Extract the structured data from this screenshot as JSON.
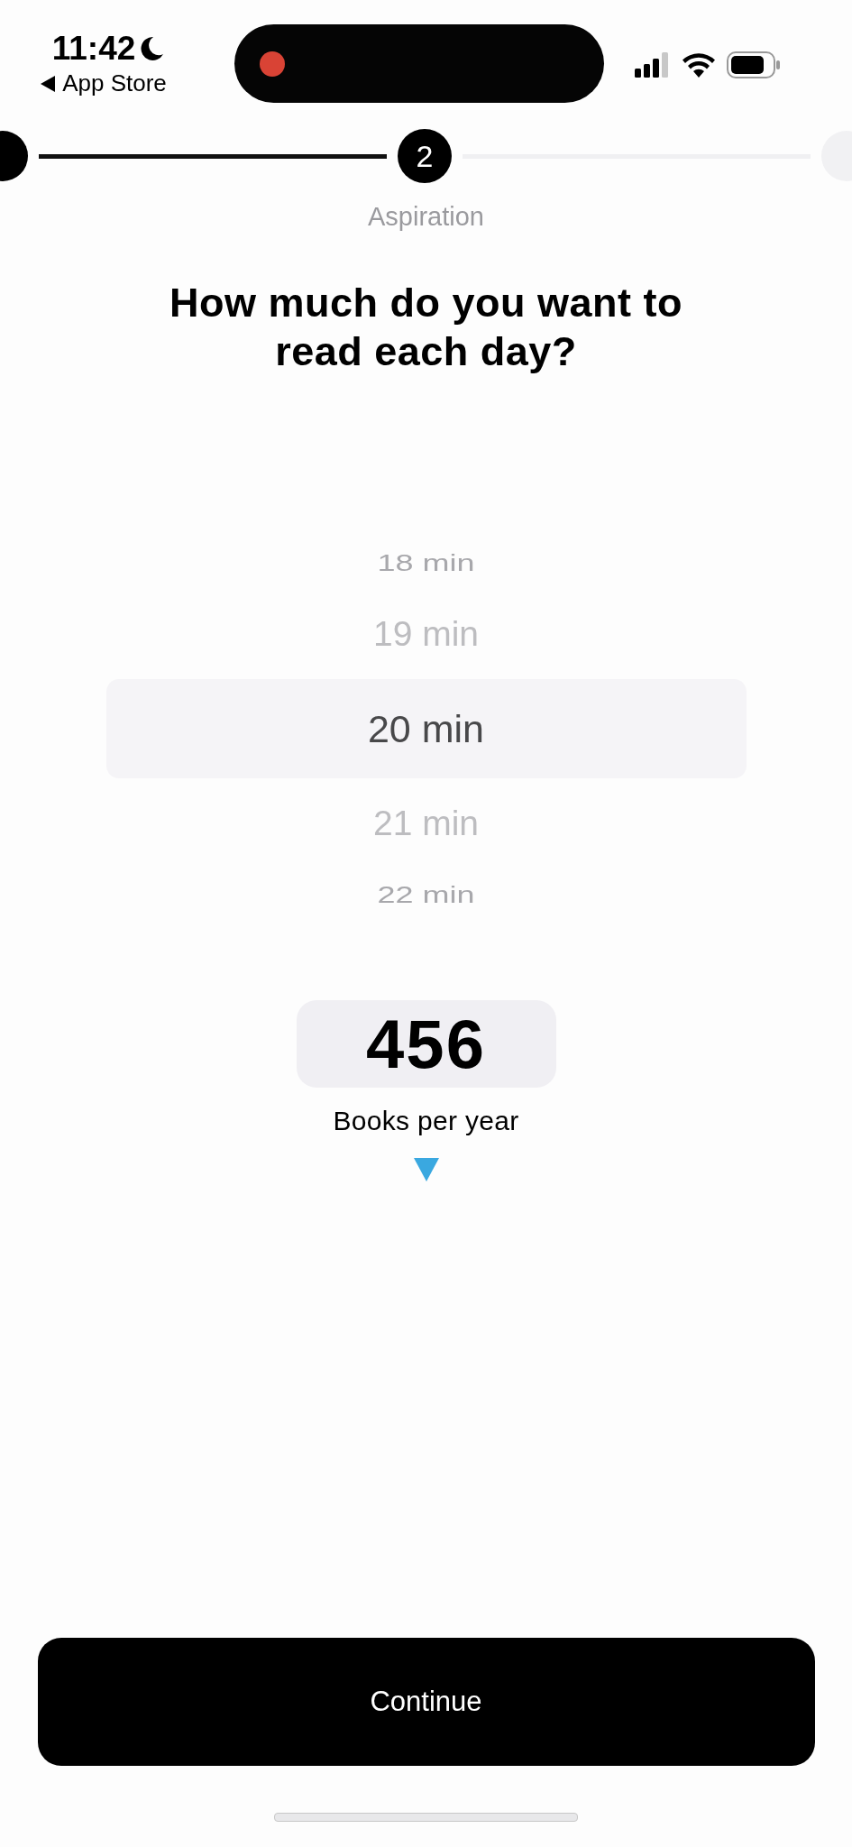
{
  "status_bar": {
    "time": "11:42",
    "back_label": "App Store"
  },
  "steps": [
    {
      "selected": false
    },
    {
      "selected": true,
      "label": "2"
    },
    {
      "selected": false
    }
  ],
  "step_caption": "Aspiration",
  "question": "How much do you want to read each day?",
  "picker": {
    "options": [
      {
        "label": "18 min",
        "selected": false
      },
      {
        "label": "19 min",
        "selected": false
      },
      {
        "label": "20 min",
        "selected": true
      },
      {
        "label": "21 min",
        "selected": false
      },
      {
        "label": "22 min",
        "selected": false
      }
    ]
  },
  "result": {
    "value": "456",
    "caption": "Books per year"
  },
  "continue_button": "Continue"
}
